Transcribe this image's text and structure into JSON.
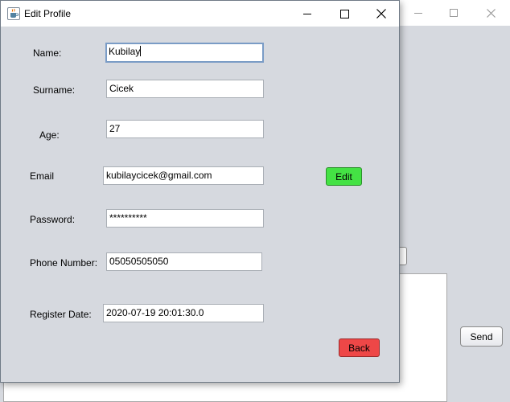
{
  "dialog": {
    "title": "Edit Profile"
  },
  "form": {
    "name": {
      "label": "Name:",
      "value": "Kubilay"
    },
    "surname": {
      "label": "Surname:",
      "value": "Cicek"
    },
    "age": {
      "label": "Age:",
      "value": "27"
    },
    "email": {
      "label": "Email",
      "value": "kubilaycicek@gmail.com"
    },
    "password": {
      "label": "Password:",
      "value": "**********"
    },
    "phone": {
      "label": "Phone Number:",
      "value": "05050505050"
    },
    "register_date": {
      "label": "Register Date:",
      "value": "2020-07-19 20:01:30.0"
    }
  },
  "buttons": {
    "edit": "Edit",
    "back": "Back"
  },
  "background_window": {
    "send": "Send"
  },
  "colors": {
    "edit_button": "#44e244",
    "back_button": "#ee4747",
    "panel_bg": "#d6d9df"
  },
  "icons": {
    "app": "java-cup-icon",
    "minimize": "minimize-icon",
    "maximize": "maximize-icon",
    "close": "close-icon"
  }
}
